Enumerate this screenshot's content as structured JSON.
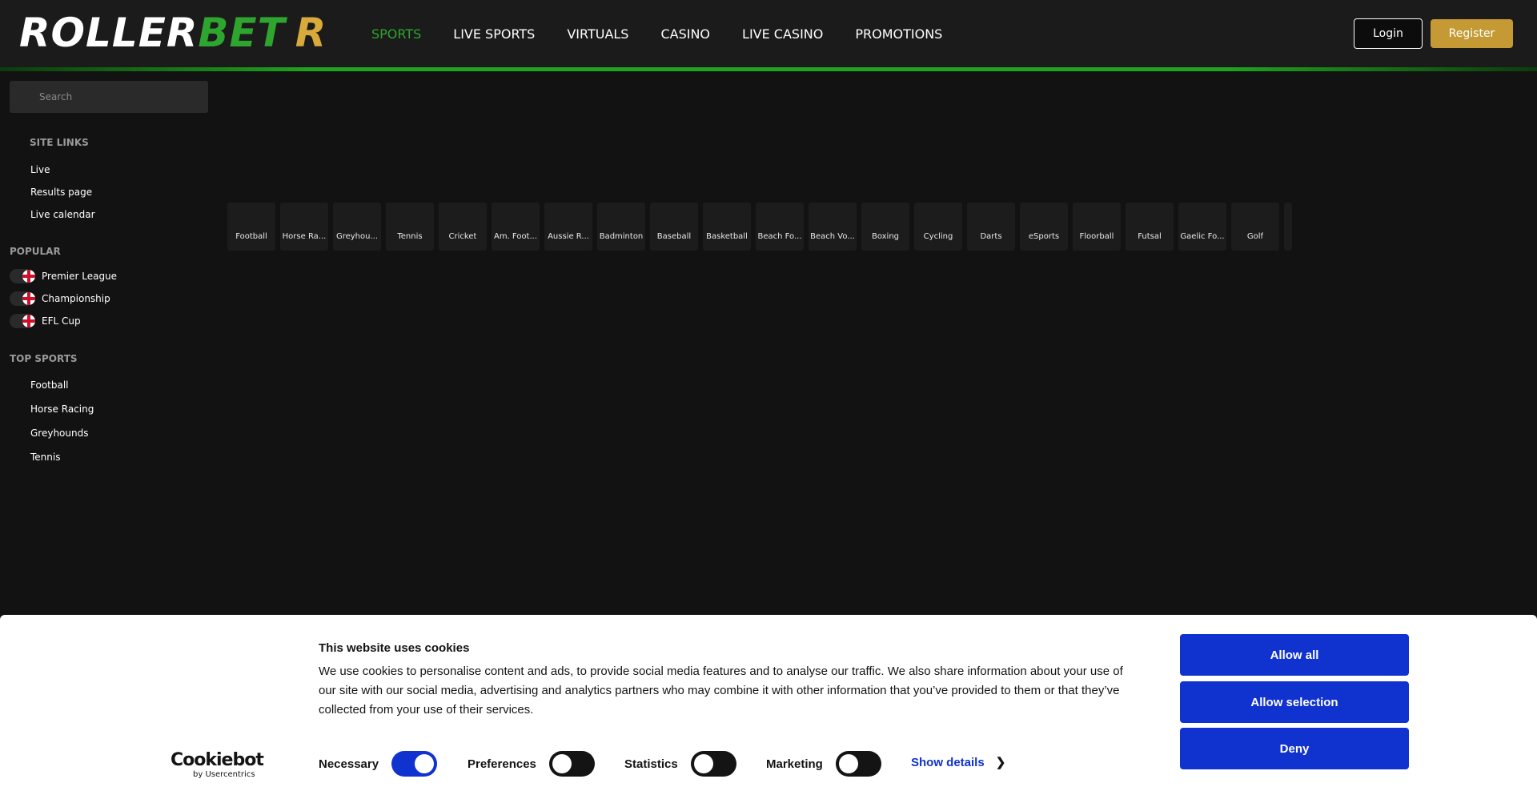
{
  "header": {
    "logo": {
      "part1": "ROLLER",
      "part2": "BET",
      "part3": "R"
    },
    "nav": [
      {
        "label": "SPORTS",
        "active": true
      },
      {
        "label": "LIVE SPORTS"
      },
      {
        "label": "VIRTUALS"
      },
      {
        "label": "CASINO"
      },
      {
        "label": "LIVE CASINO"
      },
      {
        "label": "PROMOTIONS"
      }
    ],
    "login_label": "Login",
    "register_label": "Register"
  },
  "sidebar": {
    "search_placeholder": "Search",
    "site_links_heading": "SITE LINKS",
    "site_links": [
      "Live",
      "Results page",
      "Live calendar"
    ],
    "popular_heading": "POPULAR",
    "popular": [
      "Premier League",
      "Championship",
      "EFL Cup"
    ],
    "top_sports_heading": "TOP SPORTS",
    "top_sports": [
      "Football",
      "Horse Racing",
      "Greyhounds",
      "Tennis"
    ]
  },
  "sports": [
    "Football",
    "Horse Ra...",
    "Greyhou...",
    "Tennis",
    "Cricket",
    "Am. Foot...",
    "Aussie R...",
    "Badminton",
    "Baseball",
    "Basketball",
    "Beach Fo...",
    "Beach Vo...",
    "Boxing",
    "Cycling",
    "Darts",
    "eSports",
    "Floorball",
    "Futsal",
    "Gaelic Fo...",
    "Golf"
  ],
  "cookie": {
    "title": "This website uses cookies",
    "text": "We use cookies to personalise content and ads, to provide social media features and to analyse our traffic. We also share information about your use of our site with our social media, advertising and analytics partners who may combine it with other information that you’ve provided to them or that they’ve collected from your use of their services.",
    "brand": "Cookiebot",
    "brand_sub": "by Usercentrics",
    "consents": [
      {
        "label": "Necessary",
        "on": true
      },
      {
        "label": "Preferences",
        "on": false
      },
      {
        "label": "Statistics",
        "on": false
      },
      {
        "label": "Marketing",
        "on": false
      }
    ],
    "show_details": "Show details",
    "allow_all": "Allow all",
    "allow_selection": "Allow selection",
    "deny": "Deny"
  },
  "colors": {
    "accent_green": "#2ea52e",
    "gold": "#c59a35",
    "cookie_blue": "#1032cf"
  }
}
